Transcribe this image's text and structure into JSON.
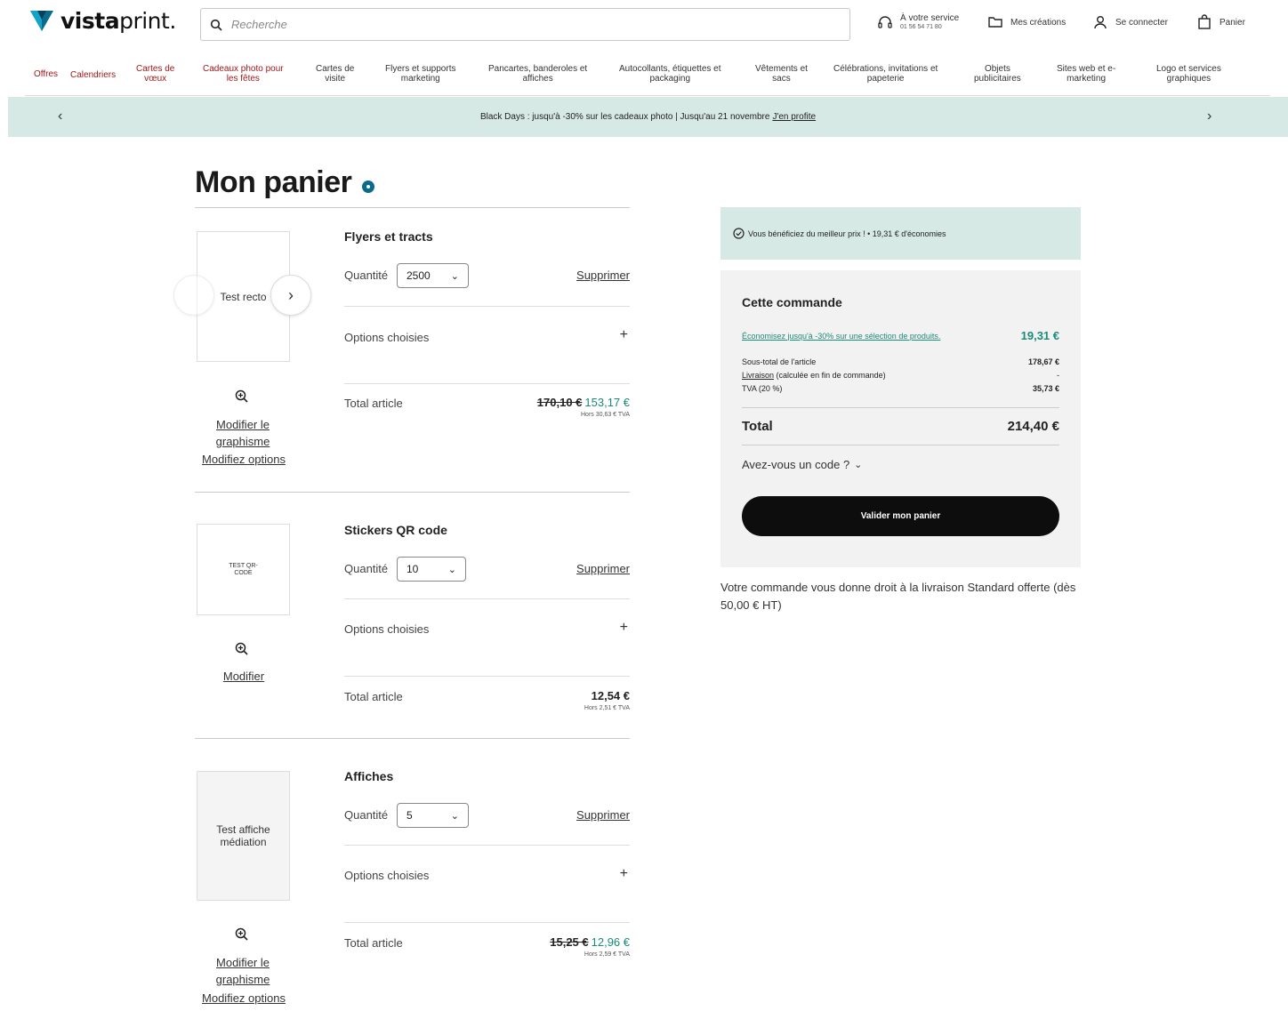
{
  "header": {
    "logo_bold": "vista",
    "logo_rest": "print",
    "logo_dot": ".",
    "search_placeholder": "Recherche",
    "service_label": "À votre service",
    "service_phone": "01 56 54 71 80",
    "creations_label": "Mes créations",
    "login_label": "Se connecter",
    "cart_label": "Panier"
  },
  "nav": [
    {
      "label": "Offres",
      "red": true
    },
    {
      "label": "Calendriers",
      "red": true
    },
    {
      "label": "Cartes de\nvœux",
      "red": true
    },
    {
      "label": "Cadeaux photo pour\nles fêtes",
      "red": true
    },
    {
      "label": "Cartes de\nvisite",
      "red": false
    },
    {
      "label": "Flyers et supports\nmarketing",
      "red": false
    },
    {
      "label": "Pancartes, banderoles et\naffiches",
      "red": false
    },
    {
      "label": "Autocollants, étiquettes et\npackaging",
      "red": false
    },
    {
      "label": "Vêtements et\nsacs",
      "red": false
    },
    {
      "label": "Célébrations, invitations et\npapeterie",
      "red": false
    },
    {
      "label": "Objets\npublicitaires",
      "red": false
    },
    {
      "label": "Sites web et e-\nmarketing",
      "red": false
    },
    {
      "label": "Logo et services\ngraphiques",
      "red": false
    }
  ],
  "promo": {
    "text": "Black Days : jusqu'à -30% sur les cadeaux photo | Jusqu'au 21 novembre",
    "link": "J'en profite"
  },
  "cart": {
    "title": "Mon panier",
    "qty_label": "Quantité",
    "remove_label": "Supprimer",
    "options_label": "Options choisies",
    "total_label": "Total article",
    "items": [
      {
        "name": "Flyers et tracts",
        "thumb_text": "Test recto",
        "quantity": "2500",
        "price_old": "170,10 €",
        "price_new": "153,17 €",
        "price_ht": "Hors 30,63 € TVA",
        "edit_design": "Modifier le graphisme",
        "edit_options": "Modifiez options"
      },
      {
        "name": "Stickers QR code",
        "thumb_text": "TEST QR-CODE",
        "quantity": "10",
        "price": "12,54 €",
        "price_ht": "Hors 2,51 € TVA",
        "edit": "Modifier"
      },
      {
        "name": "Affiches",
        "thumb_text": "Test affiche médiation",
        "quantity": "5",
        "price_old": "15,25 €",
        "price_new": "12,96 €",
        "price_ht": "Hors 2,59 € TVA",
        "edit_design": "Modifier le graphisme",
        "edit_options": "Modifiez options"
      }
    ]
  },
  "summary": {
    "savings_text": "Vous bénéficiez du meilleur prix ! • 19,31 € d'économies",
    "title": "Cette commande",
    "promo_link": "Économisez jusqu'à -30% sur une sélection de produits.",
    "promo_value": "19,31 €",
    "subtotal_label": "Sous-total de l'article",
    "subtotal_value": "178,67 €",
    "delivery_link": "Livraison",
    "delivery_label": "(calculée en fin de commande)",
    "delivery_value": "-",
    "vat_label": "TVA (20 %)",
    "vat_value": "35,73 €",
    "total_label": "Total",
    "total_value": "214,40 €",
    "code_label": "Avez-vous un code ?",
    "validate_label": "Valider mon panier",
    "delivery_note": "Votre commande vous donne droit à la livraison Standard offerte (dès 50,00 € HT)"
  },
  "colors": {
    "accent_green": "#1a8a7a",
    "promo_bg": "#d6e9e4",
    "nav_red": "#a01818",
    "button_black": "#0d0d0d"
  }
}
